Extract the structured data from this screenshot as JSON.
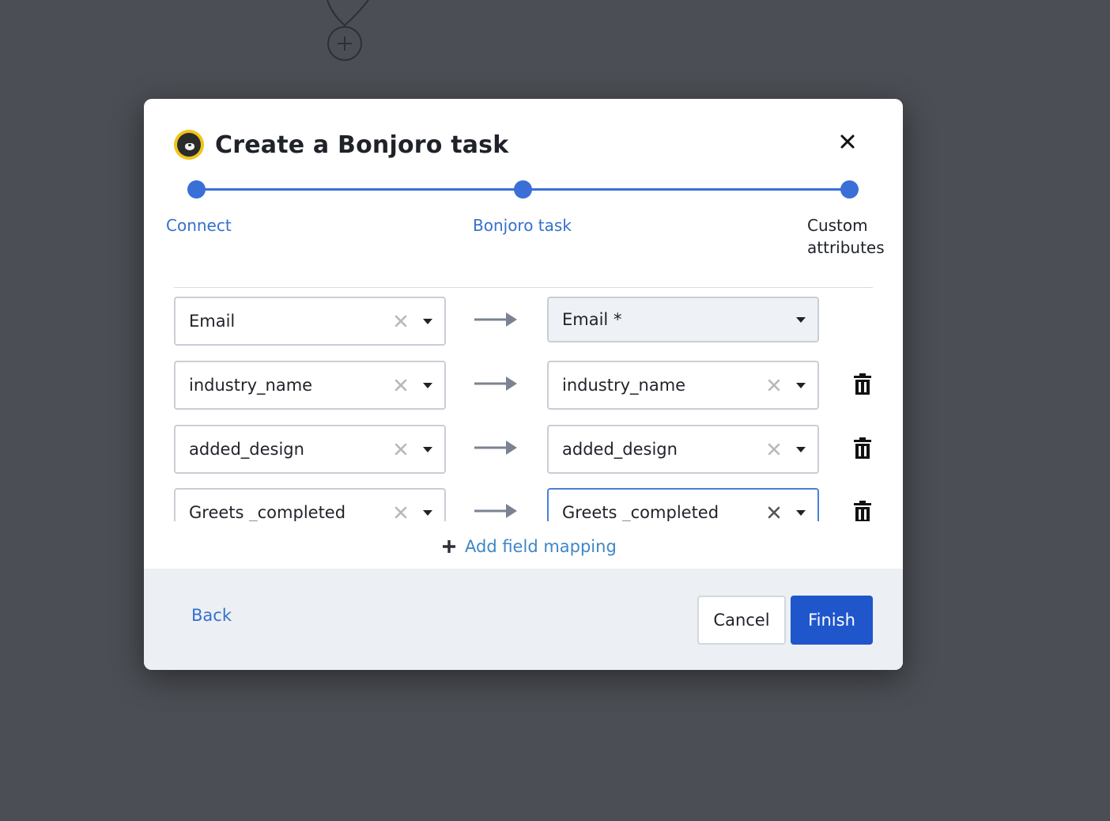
{
  "modal": {
    "title": "Create a Bonjoro task",
    "logo_icon": "bonjoro-logo-icon",
    "close_icon": "close-icon"
  },
  "stepper": {
    "steps": [
      {
        "label": "Connect",
        "state": "done"
      },
      {
        "label": "Bonjoro task",
        "state": "done"
      },
      {
        "label": "Custom\nattributes",
        "state": "current"
      }
    ],
    "accent": "#3a6fd8"
  },
  "mappings": [
    {
      "source": "Email",
      "target": "Email *",
      "target_locked": true,
      "deletable": false
    },
    {
      "source": "industry_name",
      "target": "industry_name",
      "target_locked": false,
      "deletable": true
    },
    {
      "source": "added_design",
      "target": "added_design",
      "target_locked": false,
      "deletable": true
    },
    {
      "source": "Greets _completed",
      "target": "Greets _completed",
      "target_locked": false,
      "deletable": true
    }
  ],
  "add_mapping_label": "Add field mapping",
  "footer": {
    "back_label": "Back",
    "cancel_label": "Cancel",
    "finish_label": "Finish"
  },
  "colors": {
    "primary": "#1f56cc",
    "link": "#3e86c6",
    "backdrop": "#4b4e54"
  }
}
